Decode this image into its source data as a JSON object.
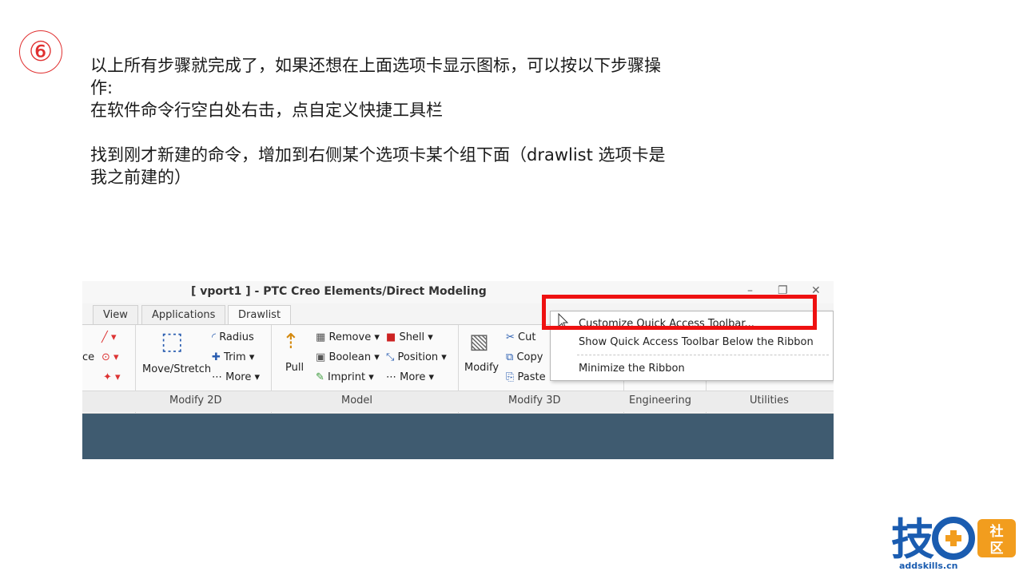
{
  "step_marker": "⑥",
  "instructions": {
    "line1": "以上所有步骤就完成了，如果还想在上面选项卡显示图标，可以按以下步骤操",
    "line2": "作:",
    "line3": "在软件命令行空白处右击，点自定义快捷工具栏",
    "line4": "找到刚才新建的命令，增加到右侧某个选项卡某个组下面（drawlist 选项卡是",
    "line5": "我之前建的）"
  },
  "screenshot": {
    "window_title": "[ vport1 ] - PTC Creo Elements/Direct Modeling",
    "tabs": [
      "View",
      "Applications",
      "Drawlist"
    ],
    "ribbon": {
      "cut_label": "Cut",
      "copy_label": "Copy",
      "paste_label": "Paste",
      "radius_label": "Radius",
      "trim_label": "Trim",
      "more_label": "More",
      "move_stretch_label": "Move/Stretch",
      "remove_label": "Remove",
      "shell_label": "Shell",
      "boolean_label": "Boolean",
      "position_label": "Position",
      "imprint_label": "Imprint",
      "pull_label": "Pull",
      "modify_label": "Modify",
      "partial_label": "ce"
    },
    "groups": [
      "Modify 2D",
      "Model",
      "Modify 3D",
      "Engineering",
      "Utilities"
    ],
    "context_menu": [
      "Customize Quick Access Toolbar...",
      "Show Quick Access Toolbar Below the Ribbon",
      "Minimize the Ribbon"
    ]
  },
  "logo": {
    "text": "技",
    "badge": "社区",
    "url": "addskills.cn"
  },
  "colors": {
    "accent_red": "#ee1111",
    "step_red": "#e03030",
    "viewport_blue": "#3f5b70",
    "logo_blue": "#1a5cb0",
    "logo_orange": "#f29d1e"
  }
}
